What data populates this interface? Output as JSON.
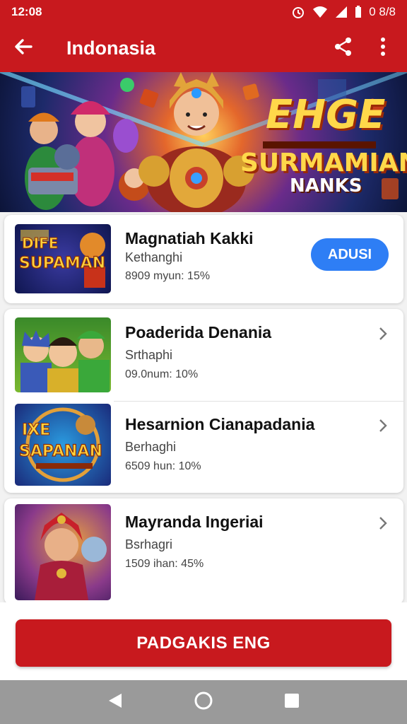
{
  "status_bar": {
    "time": "12:08",
    "battery": "0 8/8"
  },
  "app_bar": {
    "title": "Indonasia"
  },
  "banner": {
    "title_line1": "EHGE",
    "title_line2": "SURMAMIAN",
    "title_line3": "NANKS"
  },
  "featured": {
    "title": "Magnatiah Kakki",
    "subtitle": "Kethanghi",
    "meta": "8909 myun: 15%",
    "button": "ADUSI",
    "thumb_text": "SUPAMAN"
  },
  "list": [
    {
      "title": "Poaderida Denania",
      "subtitle": "Srthaphi",
      "meta": "09.0num: 10%"
    },
    {
      "title": "Hesarnion Cianapadania",
      "subtitle": "Berhaghi",
      "meta": "6509 hun: 10%",
      "thumb_text": "SAPANAN"
    },
    {
      "title": "Mayranda Ingeriai",
      "subtitle": "Bsrhagri",
      "meta": "1509 ihan: 45%"
    }
  ],
  "primary_button": "PADGAKIS ENG",
  "colors": {
    "brand": "#c8191e",
    "accent": "#2e7ef5"
  },
  "icons": [
    "back-arrow-icon",
    "share-icon",
    "more-vert-icon",
    "chevron-right-icon",
    "nav-back-icon",
    "nav-home-icon",
    "nav-recents-icon",
    "alarm-icon",
    "wifi-icon",
    "signal-icon",
    "battery-icon"
  ]
}
